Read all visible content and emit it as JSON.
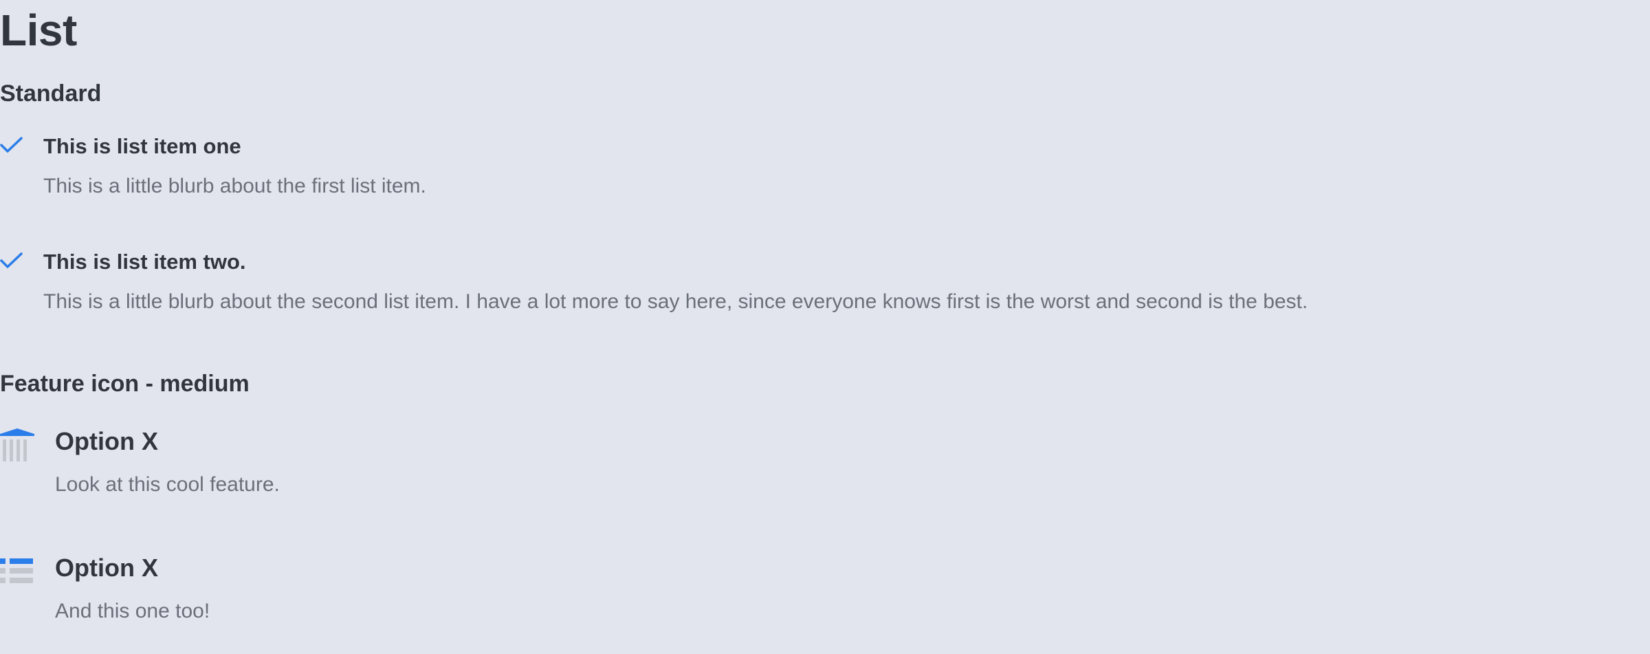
{
  "page": {
    "title": "List"
  },
  "colors": {
    "background": "#e2e5ed",
    "text_primary": "#31353e",
    "text_secondary": "#6b6f79",
    "accent": "#2b7de9",
    "icon_muted": "#c3c6cd"
  },
  "standard": {
    "heading": "Standard",
    "items": [
      {
        "icon": "check-icon",
        "title": "This is list item one",
        "description": "This is a little blurb about the first list item."
      },
      {
        "icon": "check-icon",
        "title": "This is list item two.",
        "description": "This is a little blurb about the second list item. I have a lot more to say here, since everyone knows first is the worst and second is the best."
      }
    ]
  },
  "feature": {
    "heading": "Feature icon - medium",
    "items": [
      {
        "icon": "bank-icon",
        "title": "Option X",
        "description": "Look at this cool feature."
      },
      {
        "icon": "list-icon",
        "title": "Option X",
        "description": "And this one too!"
      }
    ]
  }
}
